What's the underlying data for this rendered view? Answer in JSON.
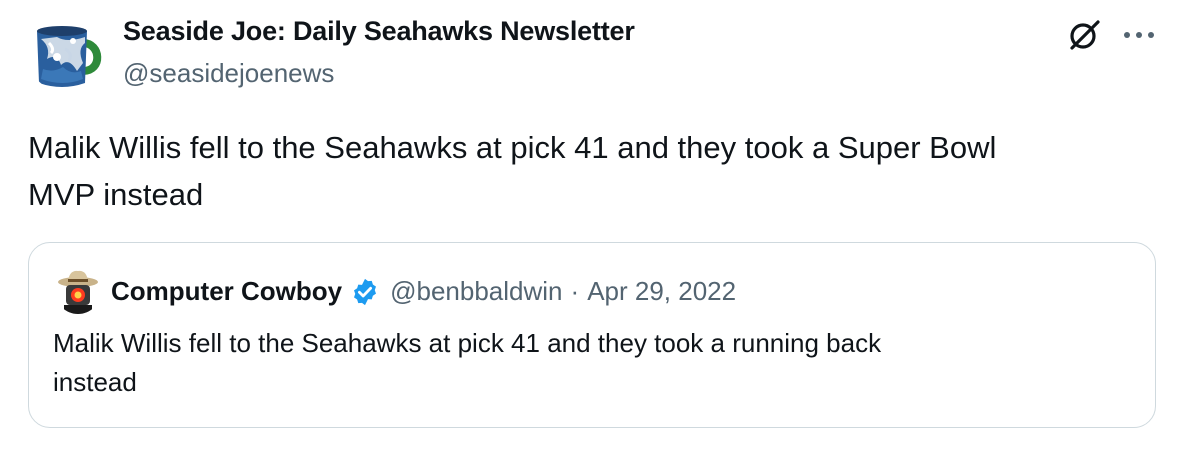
{
  "post": {
    "author": {
      "name": "Seaside Joe: Daily Seahawks Newsletter",
      "handle": "@seasidejoenews"
    },
    "text": "Malik Willis fell to the Seahawks at pick 41 and they took a Super Bowl\nMVP instead",
    "icons": {
      "avatar": "coffee-mug-avatar",
      "grok": "grok-icon",
      "more": "more-dots-icon"
    }
  },
  "quoted_post": {
    "author": {
      "name": "Computer Cowboy",
      "handle": "@benbbaldwin",
      "verified": true
    },
    "separator": "·",
    "date": "Apr 29, 2022",
    "text": "Malik Willis fell to the Seahawks at pick 41 and they took a running back\ninstead",
    "icons": {
      "avatar": "robot-cowboy-avatar",
      "verified": "verified-badge-icon"
    }
  },
  "colors": {
    "text": "#0f1419",
    "secondary": "#536471",
    "border": "#cfd9de",
    "verified": "#1d9bf0"
  }
}
